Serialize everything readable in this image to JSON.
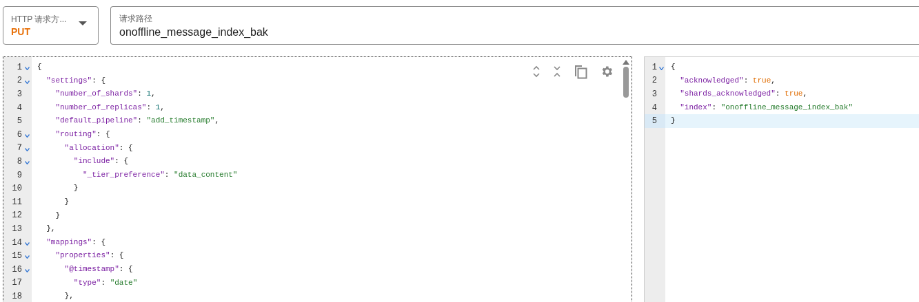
{
  "method": {
    "label": "HTTP 请求方...",
    "value": "PUT"
  },
  "path": {
    "label": "请求路径",
    "value": "onoffline_message_index_bak"
  },
  "request_editor": {
    "focused": true,
    "lines": [
      {
        "number": "1",
        "fold": true,
        "active": false,
        "tokens": [
          {
            "kind": "punct",
            "text": "{"
          }
        ]
      },
      {
        "number": "2",
        "fold": true,
        "active": false,
        "tokens": [
          {
            "kind": "key",
            "text": "  \"settings\""
          },
          {
            "kind": "punct",
            "text": ": {"
          }
        ]
      },
      {
        "number": "3",
        "fold": false,
        "active": false,
        "tokens": [
          {
            "kind": "key",
            "text": "    \"number_of_shards\""
          },
          {
            "kind": "punct",
            "text": ": "
          },
          {
            "kind": "num",
            "text": "1"
          },
          {
            "kind": "punct",
            "text": ","
          }
        ]
      },
      {
        "number": "4",
        "fold": false,
        "active": false,
        "tokens": [
          {
            "kind": "key",
            "text": "    \"number_of_replicas\""
          },
          {
            "kind": "punct",
            "text": ": "
          },
          {
            "kind": "num",
            "text": "1"
          },
          {
            "kind": "punct",
            "text": ","
          }
        ]
      },
      {
        "number": "5",
        "fold": false,
        "active": false,
        "tokens": [
          {
            "kind": "key",
            "text": "    \"default_pipeline\""
          },
          {
            "kind": "punct",
            "text": ": "
          },
          {
            "kind": "str",
            "text": "\"add_timestamp\""
          },
          {
            "kind": "punct",
            "text": ","
          }
        ]
      },
      {
        "number": "6",
        "fold": true,
        "active": false,
        "tokens": [
          {
            "kind": "key",
            "text": "    \"routing\""
          },
          {
            "kind": "punct",
            "text": ": {"
          }
        ]
      },
      {
        "number": "7",
        "fold": true,
        "active": false,
        "tokens": [
          {
            "kind": "key",
            "text": "      \"allocation\""
          },
          {
            "kind": "punct",
            "text": ": {"
          }
        ]
      },
      {
        "number": "8",
        "fold": true,
        "active": false,
        "tokens": [
          {
            "kind": "key",
            "text": "        \"include\""
          },
          {
            "kind": "punct",
            "text": ": {"
          }
        ]
      },
      {
        "number": "9",
        "fold": false,
        "active": false,
        "tokens": [
          {
            "kind": "key",
            "text": "          \"_tier_preference\""
          },
          {
            "kind": "punct",
            "text": ": "
          },
          {
            "kind": "str",
            "text": "\"data_content\""
          }
        ]
      },
      {
        "number": "10",
        "fold": false,
        "active": false,
        "tokens": [
          {
            "kind": "punct",
            "text": "        }"
          }
        ]
      },
      {
        "number": "11",
        "fold": false,
        "active": false,
        "tokens": [
          {
            "kind": "punct",
            "text": "      }"
          }
        ]
      },
      {
        "number": "12",
        "fold": false,
        "active": false,
        "tokens": [
          {
            "kind": "punct",
            "text": "    }"
          }
        ]
      },
      {
        "number": "13",
        "fold": false,
        "active": false,
        "tokens": [
          {
            "kind": "punct",
            "text": "  },"
          }
        ]
      },
      {
        "number": "14",
        "fold": true,
        "active": false,
        "tokens": [
          {
            "kind": "key",
            "text": "  \"mappings\""
          },
          {
            "kind": "punct",
            "text": ": {"
          }
        ]
      },
      {
        "number": "15",
        "fold": true,
        "active": false,
        "tokens": [
          {
            "kind": "key",
            "text": "    \"properties\""
          },
          {
            "kind": "punct",
            "text": ": {"
          }
        ]
      },
      {
        "number": "16",
        "fold": true,
        "active": false,
        "tokens": [
          {
            "kind": "key",
            "text": "      \"@timestamp\""
          },
          {
            "kind": "punct",
            "text": ": {"
          }
        ]
      },
      {
        "number": "17",
        "fold": false,
        "active": false,
        "tokens": [
          {
            "kind": "key",
            "text": "        \"type\""
          },
          {
            "kind": "punct",
            "text": ": "
          },
          {
            "kind": "str",
            "text": "\"date\""
          }
        ]
      },
      {
        "number": "18",
        "fold": false,
        "active": false,
        "tokens": [
          {
            "kind": "punct",
            "text": "      },"
          }
        ]
      }
    ]
  },
  "response_editor": {
    "focused": false,
    "lines": [
      {
        "number": "1",
        "fold": true,
        "active": false,
        "tokens": [
          {
            "kind": "punct",
            "text": "{"
          }
        ]
      },
      {
        "number": "2",
        "fold": false,
        "active": false,
        "tokens": [
          {
            "kind": "key",
            "text": "  \"acknowledged\""
          },
          {
            "kind": "punct",
            "text": ": "
          },
          {
            "kind": "bool",
            "text": "true"
          },
          {
            "kind": "punct",
            "text": ","
          }
        ]
      },
      {
        "number": "3",
        "fold": false,
        "active": false,
        "tokens": [
          {
            "kind": "key",
            "text": "  \"shards_acknowledged\""
          },
          {
            "kind": "punct",
            "text": ": "
          },
          {
            "kind": "bool",
            "text": "true"
          },
          {
            "kind": "punct",
            "text": ","
          }
        ]
      },
      {
        "number": "4",
        "fold": false,
        "active": false,
        "tokens": [
          {
            "kind": "key",
            "text": "  \"index\""
          },
          {
            "kind": "punct",
            "text": ": "
          },
          {
            "kind": "str",
            "text": "\"onoffline_message_index_bak\""
          }
        ]
      },
      {
        "number": "5",
        "fold": false,
        "active": true,
        "tokens": [
          {
            "kind": "punct",
            "text": "}"
          }
        ]
      }
    ]
  }
}
